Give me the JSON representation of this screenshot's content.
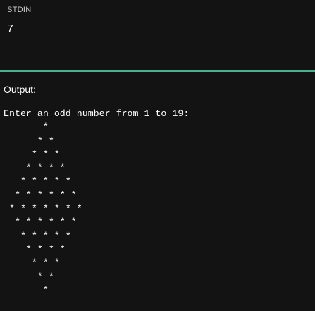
{
  "stdin": {
    "label": "STDIN",
    "value": "7"
  },
  "output": {
    "label": "Output:",
    "text": "Enter an odd number from 1 to 19:\n       *\n      * *\n     * * *\n    * * * *\n   * * * * *\n  * * * * * *\n * * * * * * *\n  * * * * * *\n   * * * * *\n    * * * *\n     * * *\n      * *\n       *"
  },
  "colors": {
    "background": "#131313",
    "divider": "#4caf8e",
    "text": "#ffffff",
    "label_muted": "#c9c9c9"
  }
}
